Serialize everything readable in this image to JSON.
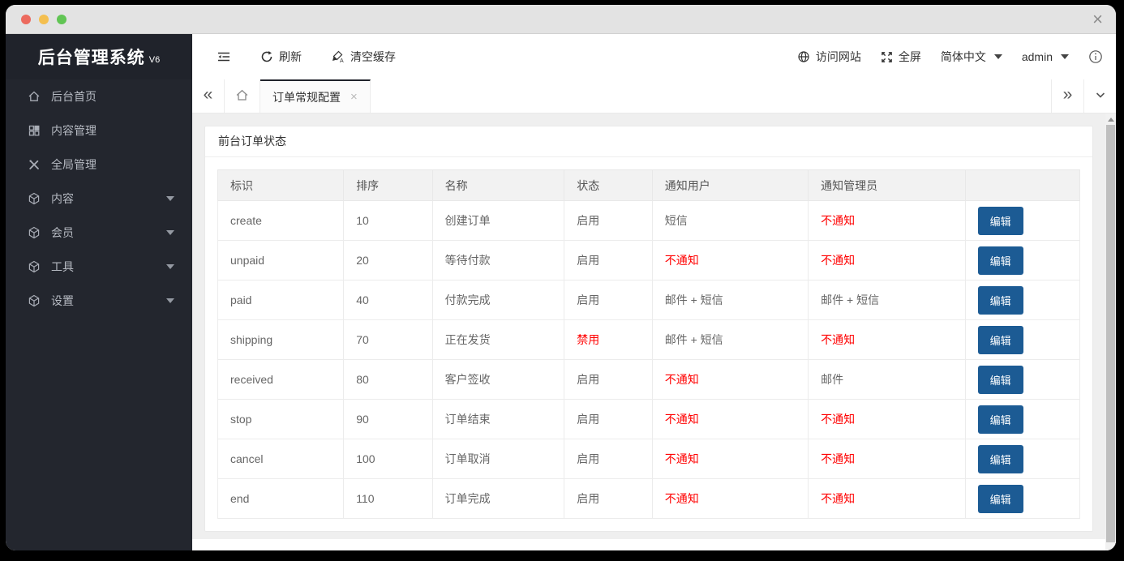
{
  "titlebar": {
    "close_glyph": "×"
  },
  "sidebar": {
    "title": "后台管理系统",
    "version": "V6",
    "items": [
      {
        "label": "后台首页",
        "icon": "home-icon",
        "caret": false
      },
      {
        "label": "内容管理",
        "icon": "grid-icon",
        "caret": false
      },
      {
        "label": "全局管理",
        "icon": "tools-icon",
        "caret": false
      },
      {
        "label": "内容",
        "icon": "cube-icon",
        "caret": true
      },
      {
        "label": "会员",
        "icon": "cube-icon",
        "caret": true
      },
      {
        "label": "工具",
        "icon": "cube-icon",
        "caret": true
      },
      {
        "label": "设置",
        "icon": "cube-icon",
        "caret": true
      }
    ]
  },
  "toolbar": {
    "refresh_label": "刷新",
    "clear_cache_label": "清空缓存",
    "visit_site_label": "访问网站",
    "fullscreen_label": "全屏",
    "language_label": "简体中文",
    "user_label": "admin"
  },
  "tabbar": {
    "back_glyph": "«",
    "forward_glyph": "»",
    "active_tab": "订单常规配置",
    "close_glyph": "×"
  },
  "panel": {
    "title": "前台订单状态"
  },
  "table": {
    "headers": [
      "标识",
      "排序",
      "名称",
      "状态",
      "通知用户",
      "通知管理员",
      ""
    ],
    "edit_label": "编辑",
    "rows": [
      {
        "key": "create",
        "sort": "10",
        "name": "创建订单",
        "status": "启用",
        "status_red": false,
        "notify_user": "短信",
        "nu_red": false,
        "notify_admin": "不通知",
        "na_red": true
      },
      {
        "key": "unpaid",
        "sort": "20",
        "name": "等待付款",
        "status": "启用",
        "status_red": false,
        "notify_user": "不通知",
        "nu_red": true,
        "notify_admin": "不通知",
        "na_red": true
      },
      {
        "key": "paid",
        "sort": "40",
        "name": "付款完成",
        "status": "启用",
        "status_red": false,
        "notify_user": "邮件 + 短信",
        "nu_red": false,
        "notify_admin": "邮件 + 短信",
        "na_red": false
      },
      {
        "key": "shipping",
        "sort": "70",
        "name": "正在发货",
        "status": "禁用",
        "status_red": true,
        "notify_user": "邮件 + 短信",
        "nu_red": false,
        "notify_admin": "不通知",
        "na_red": true
      },
      {
        "key": "received",
        "sort": "80",
        "name": "客户签收",
        "status": "启用",
        "status_red": false,
        "notify_user": "不通知",
        "nu_red": true,
        "notify_admin": "邮件",
        "na_red": false
      },
      {
        "key": "stop",
        "sort": "90",
        "name": "订单结束",
        "status": "启用",
        "status_red": false,
        "notify_user": "不通知",
        "nu_red": true,
        "notify_admin": "不通知",
        "na_red": true
      },
      {
        "key": "cancel",
        "sort": "100",
        "name": "订单取消",
        "status": "启用",
        "status_red": false,
        "notify_user": "不通知",
        "nu_red": true,
        "notify_admin": "不通知",
        "na_red": true
      },
      {
        "key": "end",
        "sort": "110",
        "name": "订单完成",
        "status": "启用",
        "status_red": false,
        "notify_user": "不通知",
        "nu_red": true,
        "notify_admin": "不通知",
        "na_red": true
      }
    ]
  },
  "colors": {
    "accent_blue": "#1c5b94",
    "danger_red": "#ff0000",
    "sidebar_bg": "#23262e"
  }
}
